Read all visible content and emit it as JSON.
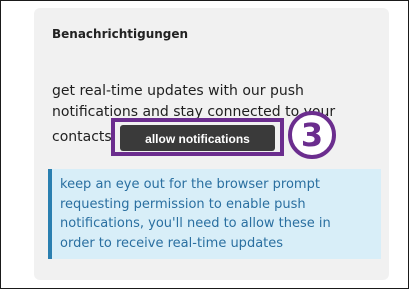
{
  "panel": {
    "title": "Benachrichtigungen",
    "body_lines": [
      "get real-time updates with our push",
      "notifications and stay connected to your",
      "contacts"
    ],
    "allow_button_label": "allow notifications",
    "step_number": "3",
    "info_lines": [
      "keep an eye out for the browser prompt",
      "requesting permission to enable push",
      "notifications, you'll need to allow these in",
      "order to receive real-time updates"
    ]
  },
  "colors": {
    "panel_bg": "#f1f1f1",
    "button_bg": "#3a3a3a",
    "highlight": "#6b2d8e",
    "info_bg": "#d8eef8",
    "info_accent": "#2a7fb0",
    "info_text": "#2a6fa0"
  }
}
